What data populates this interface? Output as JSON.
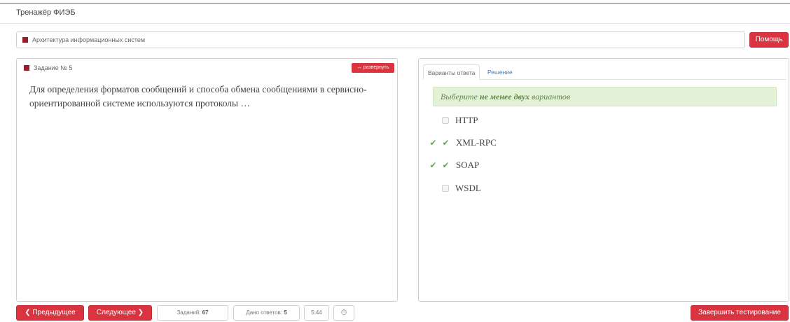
{
  "app": {
    "title": "Тренажёр ФИЭБ"
  },
  "course": {
    "name": "Архитектура информационных систем"
  },
  "header": {
    "help_label": "Помощь"
  },
  "task": {
    "title": "Задание № 5",
    "expand_label": "↔ развернуть",
    "question": "Для определения форматов сообщений и способа обмена сообщениями в сервисно-ориентированной системе используются протоколы …"
  },
  "answers": {
    "tabs": [
      {
        "label": "Варианты ответа",
        "active": true
      },
      {
        "label": "Решение",
        "active": false
      }
    ],
    "hint_prefix": "Выберите ",
    "hint_bold": "не менее двух",
    "hint_suffix": " вариантов",
    "options": [
      {
        "label": "HTTP",
        "checked": false,
        "correct": false
      },
      {
        "label": "XML-RPC",
        "checked": true,
        "correct": true
      },
      {
        "label": "SOAP",
        "checked": true,
        "correct": true
      },
      {
        "label": "WSDL",
        "checked": false,
        "correct": false
      }
    ]
  },
  "footer": {
    "prev_label": "❮ Предыдущее",
    "next_label": "Следующее ❯",
    "tasks_label": "Заданий:",
    "tasks_count": "67",
    "answered_label": "Дано ответов:",
    "answered_count": "5",
    "timer": "5:44",
    "finish_label": "Завершить тестирование"
  },
  "colors": {
    "accent": "#d9343f",
    "success_bg": "#e3f1d7",
    "success_text": "#5d8a3f",
    "check": "#6aa84f",
    "link": "#3a7bbf"
  }
}
